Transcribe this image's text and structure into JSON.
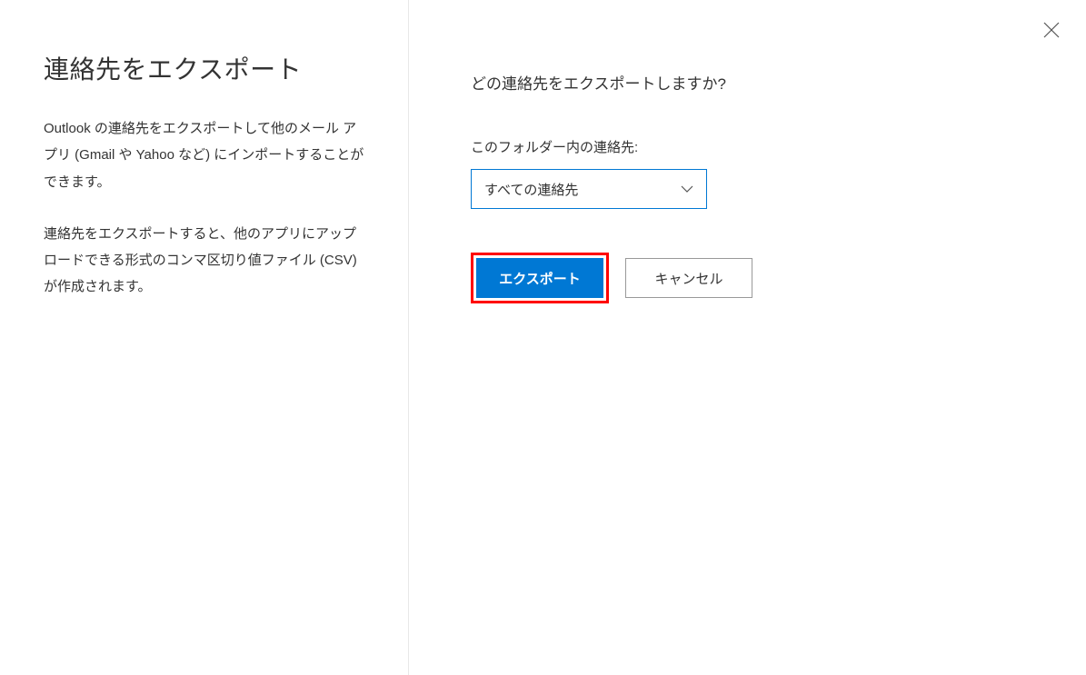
{
  "left": {
    "title": "連絡先をエクスポート",
    "description1": "Outlook の連絡先をエクスポートして他のメール アプリ (Gmail や Yahoo など) にインポートすることができます。",
    "description2": "連絡先をエクスポートすると、他のアプリにアップロードできる形式のコンマ区切り値ファイル (CSV) が作成されます。"
  },
  "right": {
    "question": "どの連絡先をエクスポートしますか?",
    "folder_label": "このフォルダー内の連絡先:",
    "dropdown_value": "すべての連絡先",
    "export_button": "エクスポート",
    "cancel_button": "キャンセル"
  },
  "colors": {
    "primary": "#0078d4",
    "highlight": "#ff0000"
  }
}
